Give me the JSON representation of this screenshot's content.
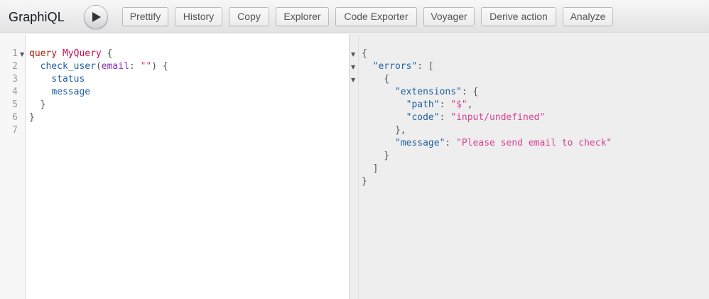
{
  "app": {
    "title": "GraphiQL"
  },
  "toolbar": {
    "run_icon": "play-icon",
    "buttons": [
      "Prettify",
      "History",
      "Copy",
      "Explorer",
      "Code Exporter",
      "Voyager",
      "Derive action",
      "Analyze"
    ]
  },
  "query_editor": {
    "line_numbers": [
      "1",
      "2",
      "3",
      "4",
      "5",
      "6",
      "7"
    ],
    "tokens": {
      "kw_query": "query",
      "op_name": "MyQuery",
      "brace_open": " {",
      "field": "check_user",
      "paren_open": "(",
      "arg_name": "email",
      "colon": ": ",
      "arg_value": "\"\"",
      "paren_close_brace": ") {",
      "status": "status",
      "message": "message",
      "close_inner": "}",
      "close_outer": "}"
    }
  },
  "result": {
    "tokens": {
      "open_obj": "{",
      "errors_key": "\"errors\"",
      "colon_bracket": ": [",
      "open_item": "{",
      "extensions_key": "\"extensions\"",
      "colon_brace": ": {",
      "path_key": "\"path\"",
      "colon1": ": ",
      "path_value": "\"$\"",
      "comma1": ",",
      "code_key": "\"code\"",
      "colon2": ": ",
      "code_value": "\"input/undefined\"",
      "close_ext": "},",
      "message_key": "\"message\"",
      "colon3": ": ",
      "message_value": "\"Please send email to check\"",
      "close_item": "}",
      "close_array": "]",
      "close_obj": "}"
    }
  },
  "colors": {
    "keyword": "#b11a04",
    "definition": "#d2054e",
    "property": "#1f61a0",
    "attribute": "#8b2bb9",
    "string": "#d64292"
  }
}
